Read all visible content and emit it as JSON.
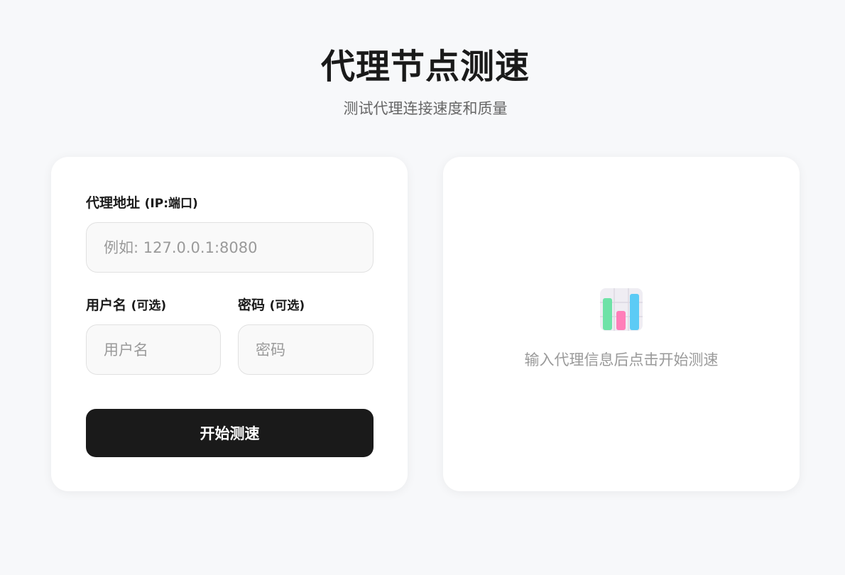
{
  "header": {
    "title": "代理节点测速",
    "subtitle": "测试代理连接速度和质量"
  },
  "form": {
    "proxy_label": "代理地址",
    "proxy_hint": "(IP:端口)",
    "proxy_placeholder": "例如: 127.0.0.1:8080",
    "proxy_value": "",
    "username_label": "用户名",
    "username_hint": "(可选)",
    "username_placeholder": "用户名",
    "username_value": "",
    "password_label": "密码",
    "password_hint": "(可选)",
    "password_placeholder": "密码",
    "password_value": "",
    "start_button": "开始测速"
  },
  "result": {
    "icon": "bar-chart-icon",
    "empty_message": "输入代理信息后点击开始测速"
  },
  "colors": {
    "background": "#f7f8fa",
    "card": "#ffffff",
    "primary_button": "#1a1a1a",
    "chart_green": "#6ee2a7",
    "chart_pink": "#ff7eb9",
    "chart_blue": "#5ccbf5"
  }
}
